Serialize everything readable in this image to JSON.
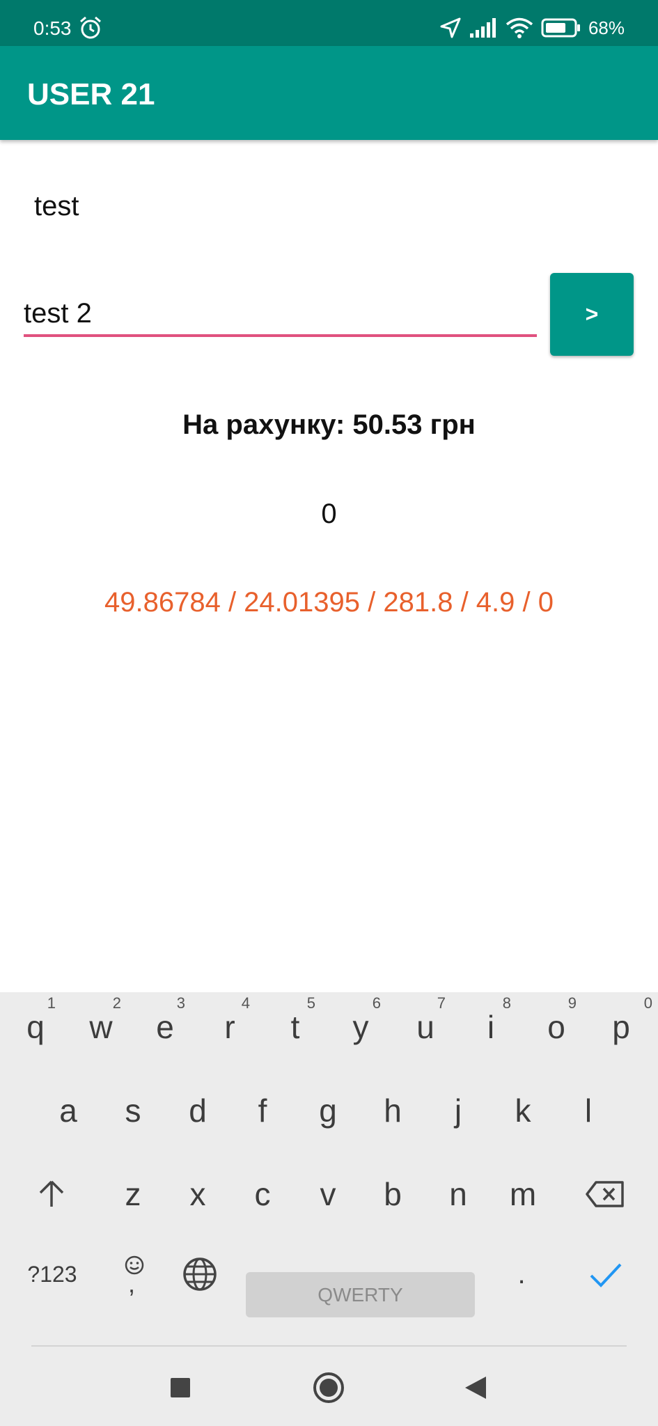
{
  "status_bar": {
    "time": "0:53",
    "battery": "68%",
    "icons": [
      "alarm-icon",
      "location-arrow-icon",
      "signal-icon",
      "wifi-icon",
      "battery-icon"
    ]
  },
  "app_bar": {
    "title": "USER 21",
    "color": "#009688"
  },
  "content": {
    "label": "test",
    "input_value": "test 2",
    "send_label": ">",
    "balance": "На рахунку: 50.53 грн",
    "counter": "0",
    "coords": "49.86784 / 24.01395 / 281.8 / 4.9 / 0"
  },
  "keyboard": {
    "row1": [
      {
        "key": "q",
        "hint": "1"
      },
      {
        "key": "w",
        "hint": "2"
      },
      {
        "key": "e",
        "hint": "3"
      },
      {
        "key": "r",
        "hint": "4"
      },
      {
        "key": "t",
        "hint": "5"
      },
      {
        "key": "y",
        "hint": "6"
      },
      {
        "key": "u",
        "hint": "7"
      },
      {
        "key": "i",
        "hint": "8"
      },
      {
        "key": "o",
        "hint": "9"
      },
      {
        "key": "p",
        "hint": "0"
      }
    ],
    "row2": [
      "a",
      "s",
      "d",
      "f",
      "g",
      "h",
      "j",
      "k",
      "l"
    ],
    "row3": [
      "z",
      "x",
      "c",
      "v",
      "b",
      "n",
      "m"
    ],
    "symbols_label": "?123",
    "emoji_comma": ",",
    "space_label": "QWERTY",
    "period_label": ".",
    "accent_color": "#2196f3"
  },
  "nav_bar": {
    "icons": [
      "recents-square-icon",
      "home-circle-icon",
      "back-triangle-icon"
    ]
  }
}
